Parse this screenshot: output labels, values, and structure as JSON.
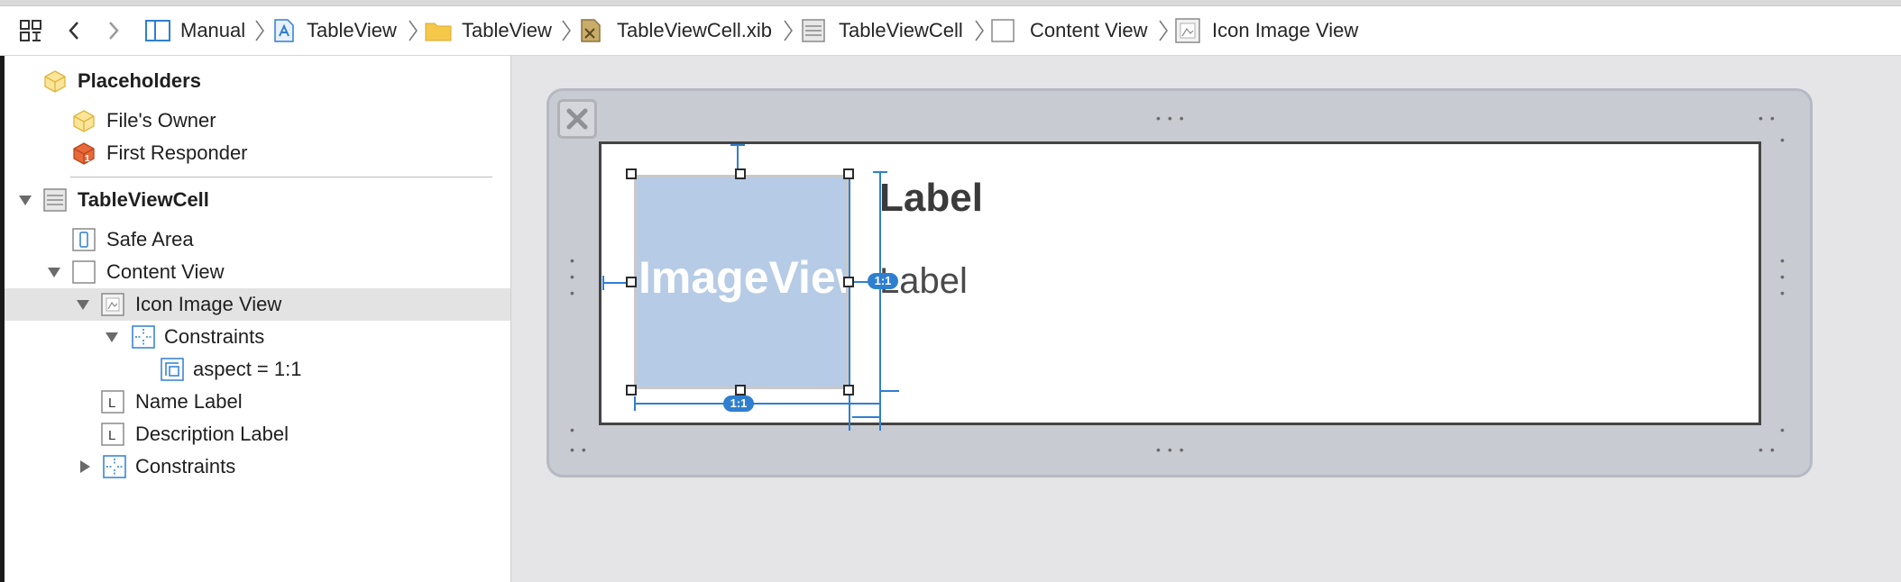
{
  "jump_bar": {
    "items": [
      {
        "label": "Manual",
        "icon": "split-view-icon"
      },
      {
        "label": "TableView",
        "icon": "app-project-icon"
      },
      {
        "label": "TableView",
        "icon": "folder-icon"
      },
      {
        "label": "TableViewCell.xib",
        "icon": "xib-file-icon"
      },
      {
        "label": "TableViewCell",
        "icon": "table-cell-icon"
      },
      {
        "label": "Content View",
        "icon": "view-icon"
      },
      {
        "label": "Icon Image View",
        "icon": "image-view-icon"
      }
    ]
  },
  "outline": {
    "placeholders": "Placeholders",
    "files_owner": "File's Owner",
    "first_responder": "First Responder",
    "table_view_cell": "TableViewCell",
    "safe_area": "Safe Area",
    "content_view": "Content View",
    "icon_image_view": "Icon Image View",
    "constraints_inner": "Constraints",
    "aspect": "aspect = 1:1",
    "name_label": "Name Label",
    "description_label": "Description Label",
    "constraints_outer": "Constraints",
    "label_glyph": "L",
    "first_responder_badge": "1"
  },
  "canvas": {
    "image_view_text": "ImageView",
    "name_label_text": "Label",
    "description_label_text": "Label",
    "aspect_badge": "1:1",
    "aspect_badge_bottom": "1:1"
  },
  "colors": {
    "accent": "#2f7fd0",
    "image_view_fill": "#b6cbe5",
    "selection": "#e3e3e3",
    "placeholder_yellow": "#f5c84a",
    "responder_orange": "#e8693a"
  }
}
